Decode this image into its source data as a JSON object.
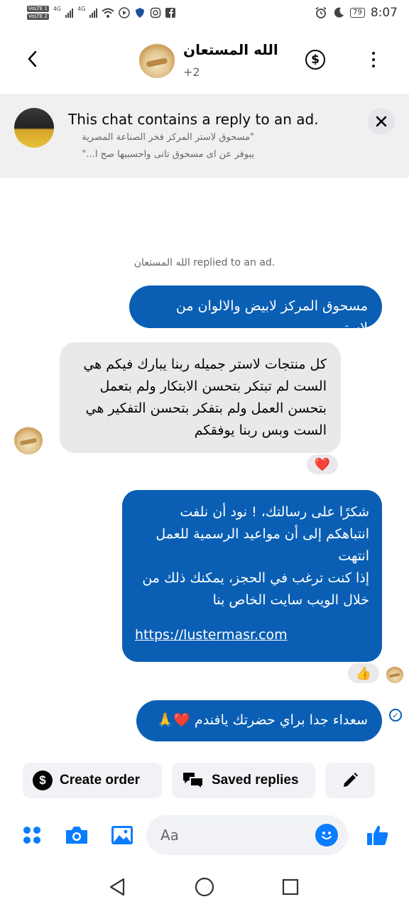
{
  "status_bar": {
    "volte_1": "VoLTE 1",
    "volte_2": "VoLTE 2",
    "network_1": "4G",
    "network_2": "4G",
    "battery": "79",
    "time": "8:07",
    "icons": [
      "signal-icon",
      "wifi-icon",
      "play-icon",
      "shield-icon",
      "instagram-icon",
      "facebook-icon",
      "alarm-icon",
      "moon-icon"
    ]
  },
  "header": {
    "back_icon": "chevron-left-icon",
    "chat_name": "الله المستعان",
    "participants_extra": "+2",
    "payment_icon": "dollar-icon",
    "more_icon": "more-vertical-icon"
  },
  "ad_banner": {
    "title": "This chat contains a reply to an ad.",
    "snippet_line1": "\"مسحوق لاستر المركز فخر الصناعة المصرية",
    "snippet_line2": "يبوفر عن اى مسحوق تانى واحسبيها صح ا...\"",
    "close_icon": "close-icon"
  },
  "conversation": {
    "replied_note": "الله المستعان replied to an ad.",
    "messages": [
      {
        "direction": "outgoing",
        "text": "مسحوق المركز لابيض والالوان من لاستر"
      },
      {
        "direction": "incoming",
        "text": "كل منتجات لاستر جميله ربنا يبارك فيكم هي الست لم تبتكر بتحسن الابتكار ولم بتعمل بتحسن العمل ولم بتفكر بتحسن التفكير هي الست وبس ربنا يوفقكم",
        "reaction": "❤️"
      },
      {
        "direction": "outgoing",
        "text_lines": [
          "شكرًا على رسالتك، ! نود أن نلفت انتباهكم إلى أن مواعيد الرسمية للعمل انتهت",
          "إذا كنت ترغب في الحجز، يمكنك ذلك من خلال الويب سايت الخاص بنا"
        ],
        "link": "https://lustermasr.com",
        "reaction": "👍"
      },
      {
        "direction": "outgoing",
        "text": "سعداء جدا براي حضرتك يافندم ❤️🙏"
      }
    ]
  },
  "quick_actions": {
    "create_order": "Create order",
    "saved_replies": "Saved replies",
    "edit_icon": "pencil-icon"
  },
  "composer": {
    "placeholder": "Aa",
    "icons": [
      "apps-grid-icon",
      "camera-icon",
      "gallery-icon",
      "emoji-icon",
      "thumbs-up-icon"
    ]
  },
  "colors": {
    "accent": "#0a5fb4",
    "bubble_incoming": "#e9e9eb",
    "banner_bg": "#f0f0f0",
    "chip_bg": "#f0f2f5"
  }
}
